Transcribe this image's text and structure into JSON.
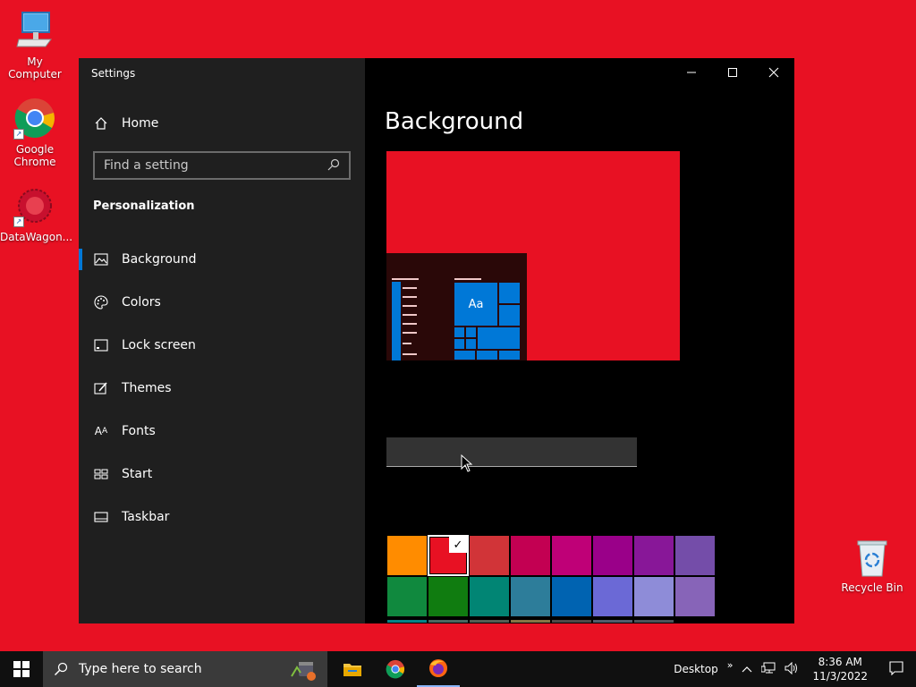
{
  "desktop": {
    "icons": [
      {
        "label": "My Computer"
      },
      {
        "label": "Google Chrome"
      },
      {
        "label": "DataWagon..."
      }
    ],
    "recycle_bin": "Recycle Bin"
  },
  "window": {
    "title": "Settings",
    "home": "Home",
    "search_placeholder": "Find a setting",
    "section": "Personalization",
    "nav": [
      {
        "label": "Background",
        "icon": "image-icon",
        "active": true
      },
      {
        "label": "Colors",
        "icon": "palette-icon"
      },
      {
        "label": "Lock screen",
        "icon": "lock-screen-icon"
      },
      {
        "label": "Themes",
        "icon": "themes-icon"
      },
      {
        "label": "Fonts",
        "icon": "fonts-icon"
      },
      {
        "label": "Start",
        "icon": "start-icon"
      },
      {
        "label": "Taskbar",
        "icon": "taskbar-icon"
      }
    ],
    "page_title": "Background",
    "tile_label": "Aa",
    "fonts_glyph": "A",
    "swatches": [
      "#ff8c00",
      "#e81123",
      "#d13438",
      "#c30052",
      "#bf0077",
      "#9a0089",
      "#881798",
      "#744da9",
      "#10893e",
      "#107c10",
      "#018574",
      "#2d7d9a",
      "#0063b1",
      "#6b69d6",
      "#8e8cd8",
      "#8764b8"
    ],
    "swatches_row3": [
      "#038387",
      "#486860",
      "#525e54",
      "#847545",
      "#4c4a48",
      "#515c6b",
      "#4a5459",
      "#000000"
    ],
    "selected_swatch": 1
  },
  "taskbar": {
    "search_placeholder": "Type here to search",
    "desktop_label": "Desktop",
    "time": "8:36 AM",
    "date": "11/3/2022"
  },
  "colors": {
    "desktop_bg": "#e81123",
    "accent": "#0078d7"
  }
}
